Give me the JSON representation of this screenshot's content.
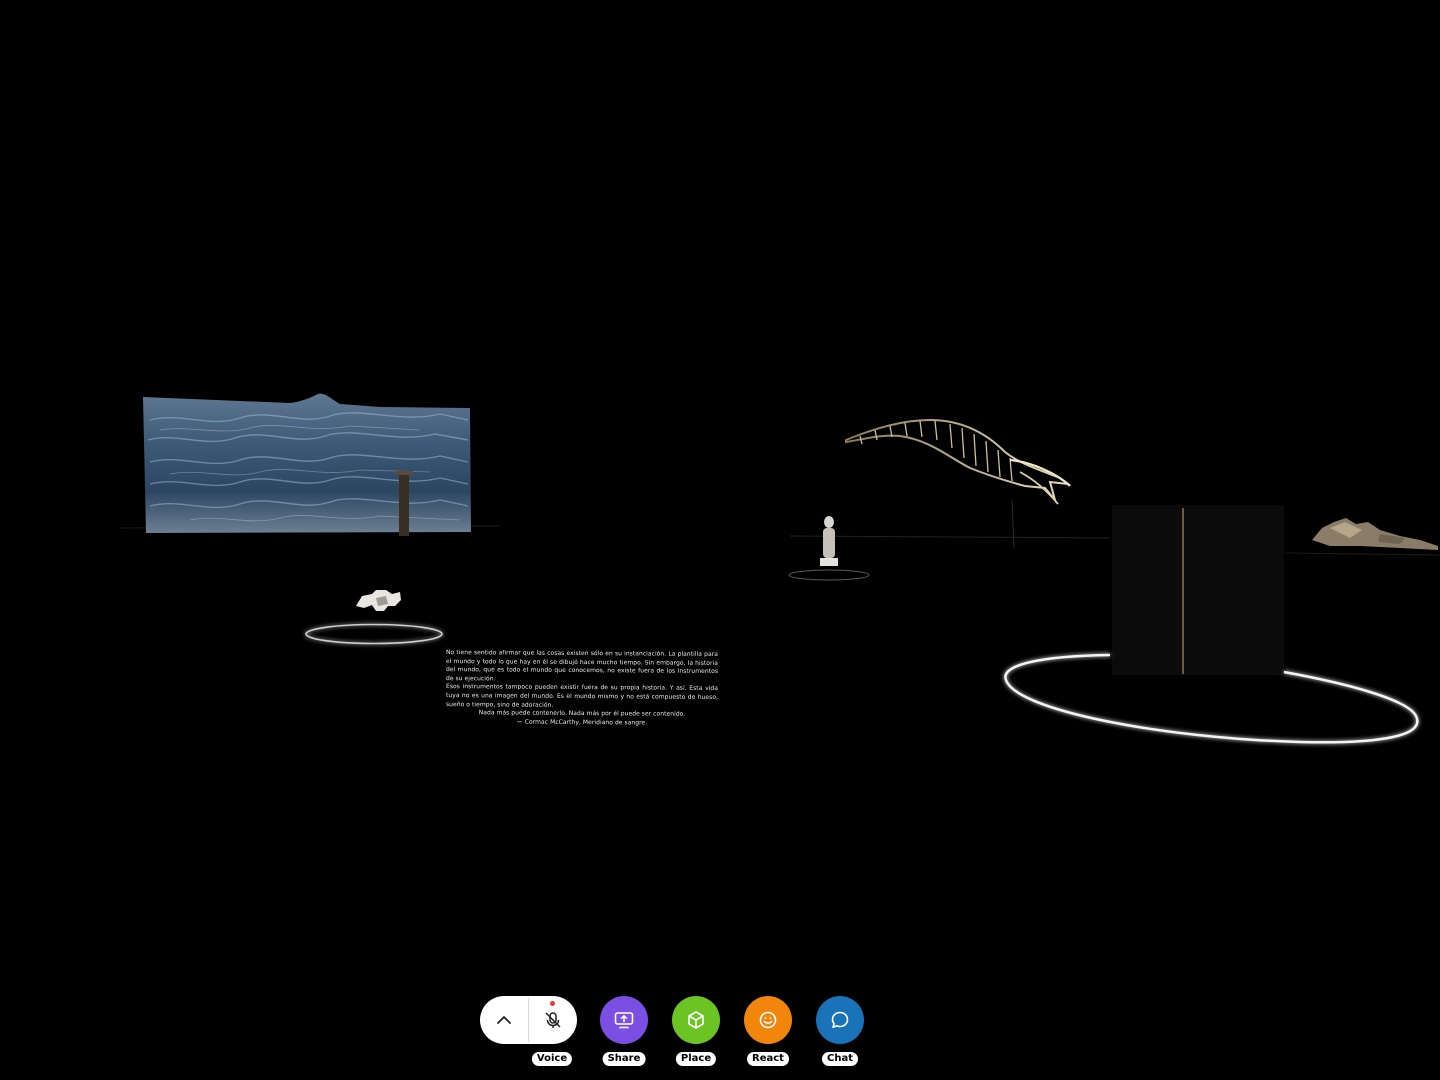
{
  "scene": {
    "quote": {
      "paragraphs": [
        "No tiene sentido afirmar que las cosas existen sólo en su instanciación. La plantilla para el mundo y todo lo que hay en él se dibujó hace mucho tiempo. Sin embargo, la historia del mundo, que es todo el mundo que conocemos, no existe fuera de los instrumentos de su ejecución.",
        "Esos instrumentos tampoco pueden existir fuera de su propia historia. Y así. Esta vida tuya no es una imagen del mundo. Es el mundo mismo y no está compuesto de hueso, sueño o tiempo, sino de adoración.",
        "Nada más puede contenerlo. Nada más por él puede ser contenido.",
        "— Cormac McCarthy, Meridiano de sangre."
      ]
    }
  },
  "toolbar": {
    "expand": {
      "icon": "chevron-up-icon"
    },
    "voice": {
      "label": "Voice",
      "icon": "microphone-muted-icon",
      "indicator_color": "#e53935"
    },
    "share": {
      "label": "Share",
      "icon": "screen-share-icon",
      "color": "#7b4fe3"
    },
    "place": {
      "label": "Place",
      "icon": "cube-icon",
      "color": "#6cc424"
    },
    "react": {
      "label": "React",
      "icon": "smiley-icon",
      "color": "#f2850b"
    },
    "chat": {
      "label": "Chat",
      "icon": "chat-bubble-icon",
      "color": "#1a73b8"
    }
  }
}
